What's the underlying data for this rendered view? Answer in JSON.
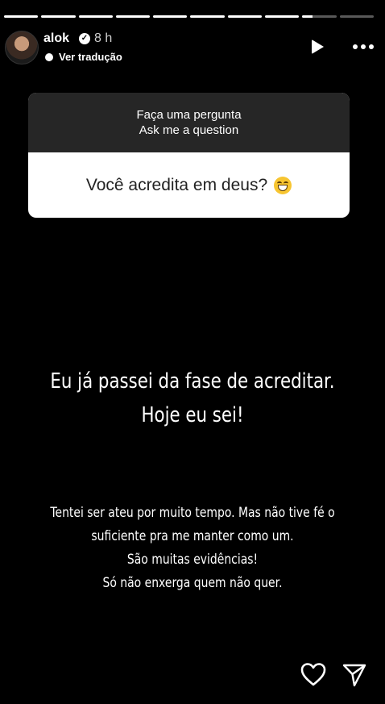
{
  "story": {
    "progress": [
      1,
      1,
      1,
      1,
      1,
      1,
      1,
      1,
      0.3,
      0
    ],
    "username": "alok",
    "verified": true,
    "time_ago": "8 h",
    "translate_label": "Ver tradução"
  },
  "question_card": {
    "prompt_line1": "Faça uma pergunta",
    "prompt_line2": "Ask me a question",
    "question": "Você acredita em deus?",
    "emoji": "grinning-face"
  },
  "answer": {
    "headline": [
      "Eu já passei da fase de acreditar.",
      "Hoje eu sei!"
    ],
    "body": [
      "Tentei ser ateu por muito tempo. Mas não tive fé o",
      "suficiente pra me manter como um.",
      "São muitas evidências!",
      "Só não enxerga quem não quer."
    ]
  },
  "icons": {
    "play": "play-icon",
    "more": "more-icon",
    "like": "heart-icon",
    "share": "send-icon"
  }
}
